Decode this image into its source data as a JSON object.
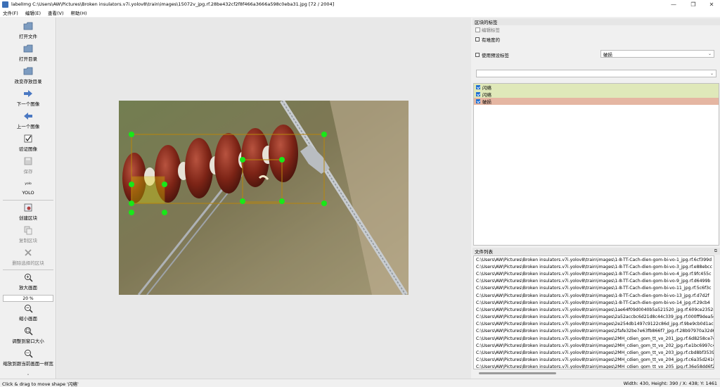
{
  "window": {
    "title": "labelImg C:\\Users\\AW\\Pictures\\Broken insulators.v7i.yolov8\\train\\images\\15072v_jpg.rf.28be432cf2f8f466a3666a598c0eba31.jpg [72 / 2004]",
    "minimize": "—",
    "restore": "❐",
    "close": "✕"
  },
  "menu": [
    "文件(F)",
    "编辑(E)",
    "查看(V)",
    "帮助(H)"
  ],
  "toolbar": {
    "open_file": "打开文件",
    "open_dir": "打开目录",
    "change_save_dir": "改变存放目录",
    "next_image": "下一个图像",
    "prev_image": "上一个图像",
    "verify_image": "验证图像",
    "save": "保存",
    "format_icon_text": "yolo",
    "format": "YOLO",
    "create_box": "创建区块",
    "copy_box": "复制区块",
    "delete_box": "删除选择的区块",
    "zoom_in": "放大画面",
    "zoom_value": "20 %",
    "zoom_out": "缩小画面",
    "fit_window": "调整到窗口大小",
    "fit_width": "缩放到跟当前画面一样宽"
  },
  "box_labels_panel": {
    "header": "区块的标签",
    "edit_label": "编辑标签",
    "difficult": "有难度的",
    "use_default_label": "使用预设标签",
    "default_label_value": "破损",
    "filter_value": "",
    "labels": [
      {
        "text": "闪络",
        "checked": true,
        "color": "#dfe8b9"
      },
      {
        "text": "闪络",
        "checked": true,
        "color": "#dfe8b9"
      },
      {
        "text": "破损",
        "checked": true,
        "color": "#e5b6a2"
      }
    ]
  },
  "file_list_panel": {
    "header": "文件列表",
    "files": [
      "C:\\Users\\AW\\Pictures\\Broken insulators.v7i.yolov8\\train\\images\\1-8-TT-Cach-dien-gom-bi-vo-1_jpg.rf.6cf399d",
      "C:\\Users\\AW\\Pictures\\Broken insulators.v7i.yolov8\\train\\images\\1-8-TT-Cach-dien-gom-bi-vo-3_jpg.rf.e88ebcc",
      "C:\\Users\\AW\\Pictures\\Broken insulators.v7i.yolov8\\train\\images\\1-8-TT-Cach-dien-gom-bi-vo-4_jpg.rf.9fc455c",
      "C:\\Users\\AW\\Pictures\\Broken insulators.v7i.yolov8\\train\\images\\1-8-TT-Cach-dien-gom-bi-vo-9_jpg.rf.d6499b",
      "C:\\Users\\AW\\Pictures\\Broken insulators.v7i.yolov8\\train\\images\\1-8-TT-Cach-dien-gom-bi-vo-11_jpg.rf.5c6f3c",
      "C:\\Users\\AW\\Pictures\\Broken insulators.v7i.yolov8\\train\\images\\1-8-TT-Cach-dien-gom-bi-vo-13_jpg.rf.d7d2f",
      "C:\\Users\\AW\\Pictures\\Broken insulators.v7i.yolov8\\train\\images\\1-8-TT-Cach-dien-gom-bi-vo-14_jpg.rf.29cb4",
      "C:\\Users\\AW\\Pictures\\Broken insulators.v7i.yolov8\\train\\images\\1ae64f09d0040b5a521520_jpg.rf.609ce23524",
      "C:\\Users\\AW\\Pictures\\Broken insulators.v7i.yolov8\\train\\images\\2a52accbc6d21d8c44c339_jpg.rf.000ff9dea5c",
      "C:\\Users\\AW\\Pictures\\Broken insulators.v7i.yolov8\\train\\images\\2e254db1497c9122c86d_jpg.rf.9be9cb0d1ac",
      "C:\\Users\\AW\\Pictures\\Broken insulators.v7i.yolov8\\train\\images\\2fafe32be7e63fb866f7_jpg.rf.28b97970a32d6",
      "C:\\Users\\AW\\Pictures\\Broken insulators.v7i.yolov8\\train\\images\\2MH_cdien_gom_tt_vo_201_jpg.rf.6d8258ce7c",
      "C:\\Users\\AW\\Pictures\\Broken insulators.v7i.yolov8\\train\\images\\2MH_cdien_gom_tt_vo_202_jpg.rf.e1bc6997c4",
      "C:\\Users\\AW\\Pictures\\Broken insulators.v7i.yolov8\\train\\images\\2MH_cdien_gom_tt_vo_203_jpg.rf.cbd8bf3539",
      "C:\\Users\\AW\\Pictures\\Broken insulators.v7i.yolov8\\train\\images\\2MH_cdien_gom_tt_vo_204_jpg.rf.c6a35d2416",
      "C:\\Users\\AW\\Pictures\\Broken insulators.v7i.yolov8\\train\\images\\2MH_cdien_gom_tt_vo_205_jpg.rf.36e58dd6f2"
    ]
  },
  "status": {
    "left": "Click & drag to move shape '闪络'",
    "right": "Width: 430, Height: 390 / X: 438; Y: 1461"
  },
  "colors": {
    "accent": "#1f6fd1",
    "vertex": "#00ff00",
    "box_outline": "#b8860b",
    "label_flash": "#dfe8b9",
    "label_broken": "#e5b6a2"
  }
}
